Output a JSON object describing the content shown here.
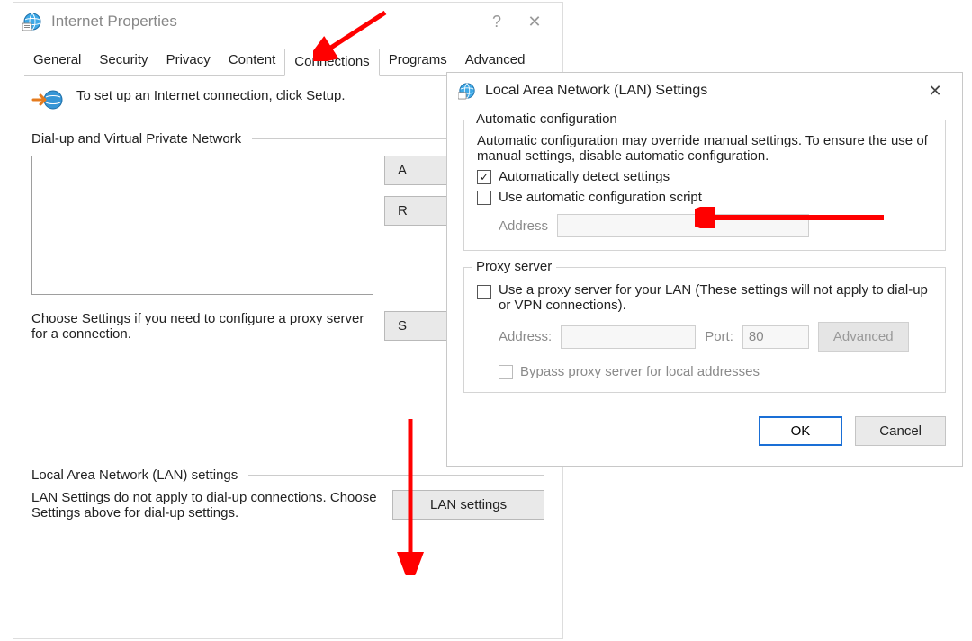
{
  "internetProps": {
    "title": "Internet Properties",
    "helpGlyph": "?",
    "closeGlyph": "✕",
    "tabs": [
      "General",
      "Security",
      "Privacy",
      "Content",
      "Connections",
      "Programs",
      "Advanced"
    ],
    "activeTab": 4,
    "setupText": "To set up an Internet connection, click Setup.",
    "dialupSection": "Dial-up and Virtual Private Network",
    "buttons": {
      "add": "Add...",
      "remove": "Remove...",
      "settings": "Settings"
    },
    "chooseText": "Choose Settings if you need to configure a proxy server for a connection.",
    "lanSection": "Local Area Network (LAN) settings",
    "lanDesc": "LAN Settings do not apply to dial-up connections. Choose Settings above for dial-up settings.",
    "lanButton": "LAN settings"
  },
  "lanDlg": {
    "title": "Local Area Network (LAN) Settings",
    "closeGlyph": "✕",
    "autoGroup": "Automatic configuration",
    "autoDesc": "Automatic configuration may override manual settings.  To ensure the use of manual settings, disable automatic configuration.",
    "cbAutoDetect": "Automatically detect settings",
    "cbAutoScript": "Use automatic configuration script",
    "addressLabel": "Address",
    "proxyGroup": "Proxy server",
    "cbProxy": "Use a proxy server for your LAN (These settings will not apply to dial-up or VPN connections).",
    "addrLabel2": "Address:",
    "portLabel": "Port:",
    "portValue": "80",
    "advanced": "Advanced",
    "cbBypass": "Bypass proxy server for local addresses",
    "ok": "OK",
    "cancel": "Cancel"
  }
}
